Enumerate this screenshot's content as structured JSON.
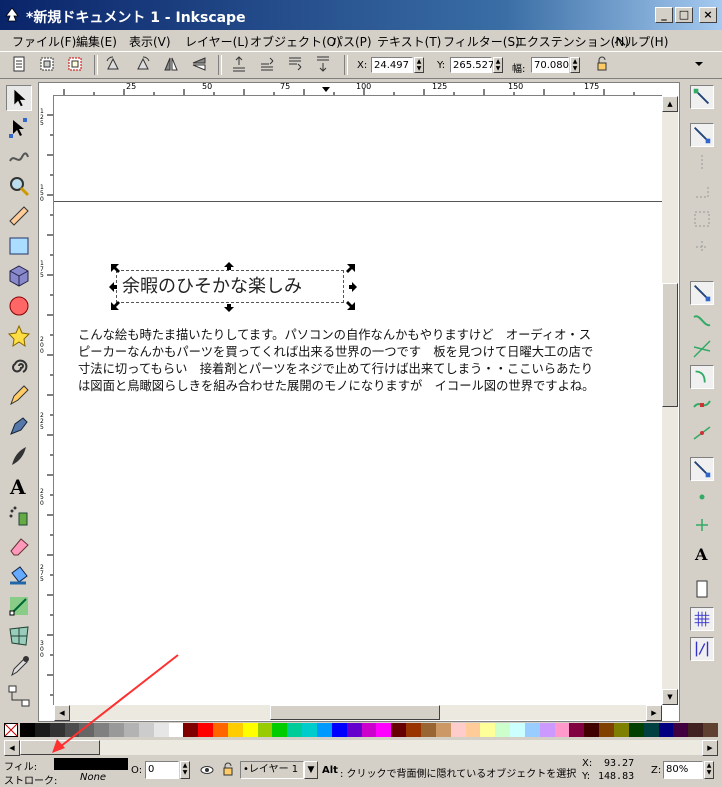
{
  "window": {
    "title": "*新規ドキュメント 1 - Inkscape",
    "buttons": [
      "_",
      "□",
      "×"
    ]
  },
  "menu": [
    "ファイル(F)",
    "編集(E)",
    "表示(V)",
    "レイヤー(L)",
    "オブジェクト(O)",
    "パス(P)",
    "テキスト(T)",
    "フィルター(S)",
    "エクステンション(N)",
    "ヘルプ(H)"
  ],
  "toolbar": {
    "x_label": "X:",
    "x_value": "24.497",
    "y_label": "Y:",
    "y_value": "265.527",
    "w_label": "幅:",
    "w_value": "70.080"
  },
  "ruler": {
    "h_ticks": [
      "25",
      "50",
      "75",
      "100",
      "125",
      "150",
      "175"
    ],
    "v_ticks": [
      "1 2 5",
      "1 5 0",
      "1 7 5",
      "2 0 0",
      "2 2 5",
      "2 5 0",
      "2 7 5",
      "3 0 0",
      "3 2 5",
      "3 5 0",
      "3 7 5",
      "4 0 0",
      "4 2 5"
    ]
  },
  "canvas": {
    "heading": "余暇のひそかな楽しみ",
    "body_lines": [
      "こんな絵も時たま描いたりしてます。パソコンの自作なんかもやりますけど　オーディオ・ス",
      "ピーカーなんかもパーツを買ってくれば出来る世界の一つです　板を見つけて日曜大工の店で",
      "寸法に切ってもらい　接着剤とパーツをネジで止めて行けば出来てしまう・・ここいらあたり",
      "は図面と鳥瞰図らしきを組み合わせた展開のモノになりますが　イコール図の世界ですよね。"
    ]
  },
  "palette": {
    "colors": [
      "#000000",
      "#1a1a1a",
      "#333333",
      "#4d4d4d",
      "#666666",
      "#808080",
      "#999999",
      "#b3b3b3",
      "#cccccc",
      "#e6e6e6",
      "#ffffff",
      "#800000",
      "#ff0000",
      "#ff6600",
      "#ffcc00",
      "#ffff00",
      "#99cc00",
      "#00cc00",
      "#00cc99",
      "#00cccc",
      "#0099ff",
      "#0000ff",
      "#6600cc",
      "#cc00cc",
      "#ff00ff",
      "#660000",
      "#993300",
      "#996633",
      "#cc9966",
      "#ffcccc",
      "#ffcc99",
      "#ffff99",
      "#ccffcc",
      "#ccffff",
      "#99ccff",
      "#cc99ff",
      "#ff99cc",
      "#800040",
      "#400000",
      "#804000",
      "#808000",
      "#004000",
      "#004040",
      "#000080",
      "#400040",
      "#402020",
      "#604030"
    ]
  },
  "status": {
    "fill_label": "フィル:",
    "stroke_label": "ストローク:",
    "stroke_value": "None",
    "opacity_label": "O:",
    "opacity_value": "0",
    "layer_value": "•レイヤー 1",
    "message_bold": "Alt",
    "message": ": クリックで背面側に隠れているオブジェクトを選択...",
    "x_label": "X:",
    "x_value": "93.27",
    "y_label": "Y:",
    "y_value": "148.83",
    "zoom_label": "Z:",
    "zoom_value": "80%"
  },
  "colors": {
    "annotation_arrow": "#ff3030",
    "titlebar_start": "#0a246a"
  }
}
